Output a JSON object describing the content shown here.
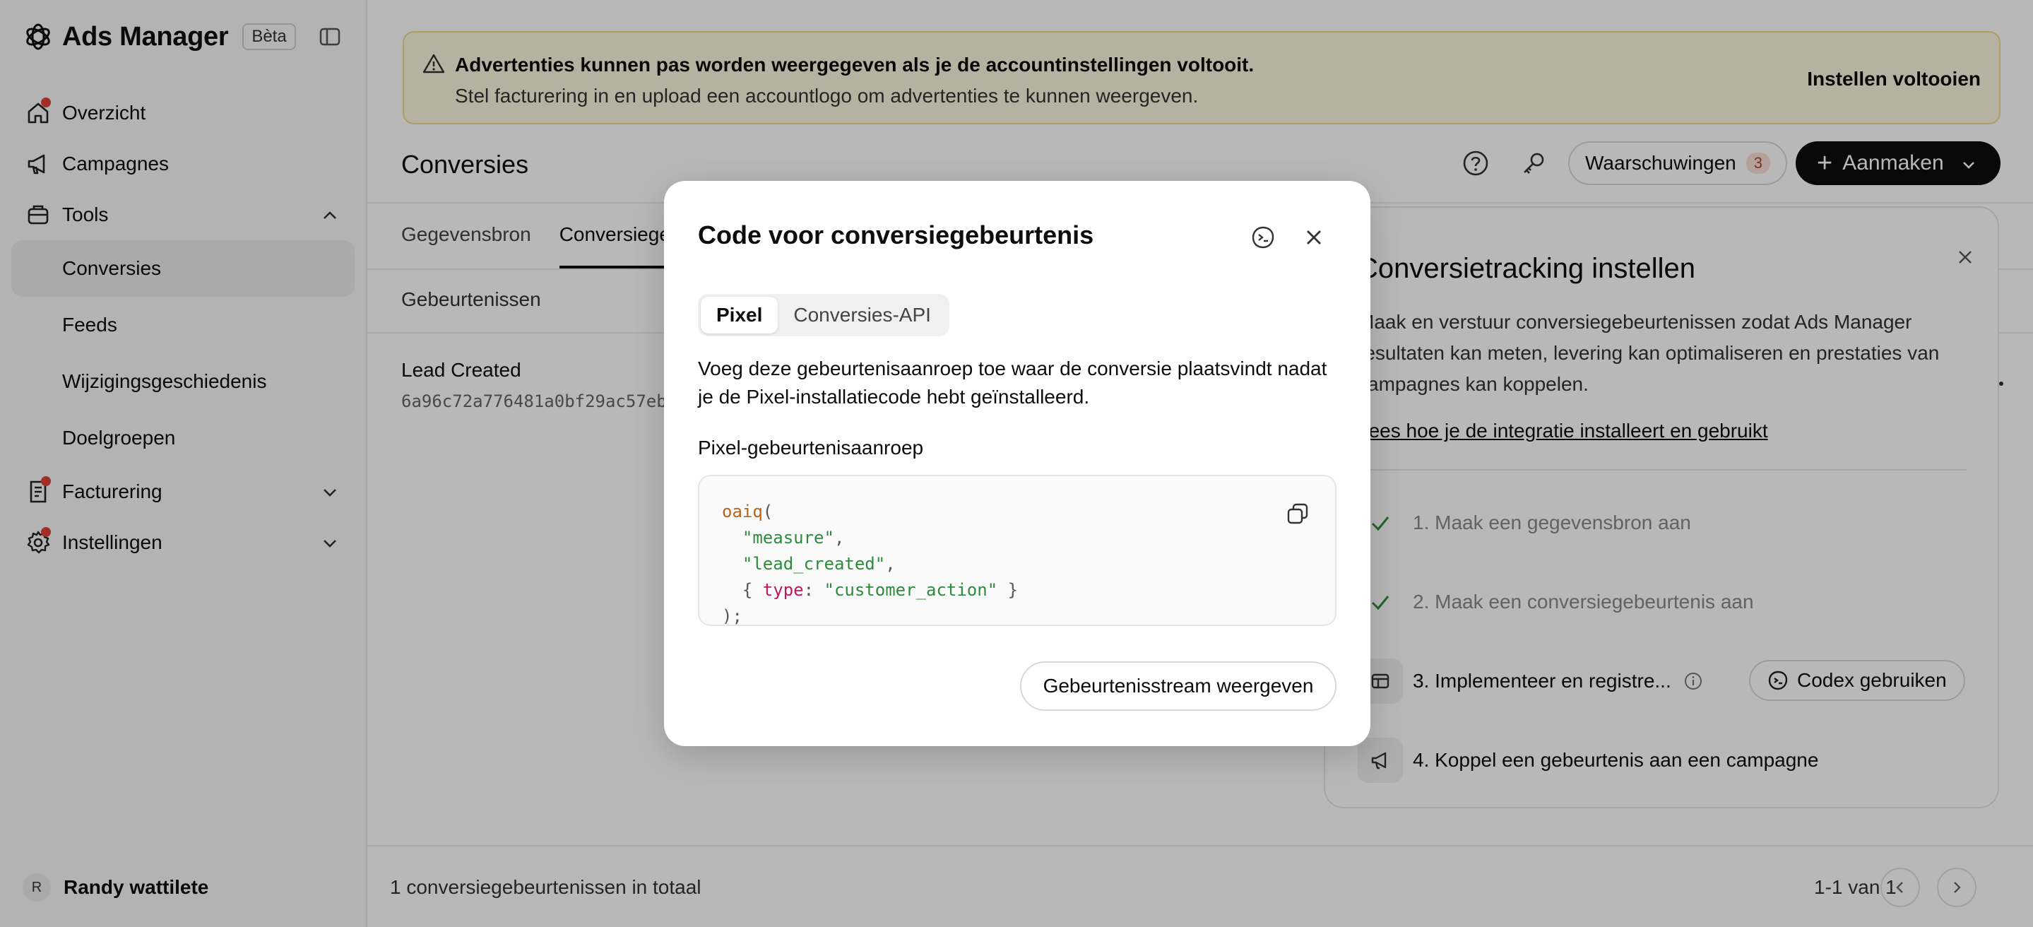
{
  "sidebar": {
    "app_title": "Ads Manager",
    "badge": "Bèta",
    "items": [
      {
        "label": "Overzicht",
        "icon": "home-icon",
        "dot": true
      },
      {
        "label": "Campagnes",
        "icon": "megaphone-icon",
        "dot": false
      },
      {
        "label": "Tools",
        "icon": "toolbox-icon",
        "dot": false,
        "expanded": true
      },
      {
        "label": "Conversies",
        "active": true
      },
      {
        "label": "Feeds"
      },
      {
        "label": "Wijzigingsgeschiedenis"
      },
      {
        "label": "Doelgroepen"
      },
      {
        "label": "Facturering",
        "icon": "receipt-icon",
        "dot": true
      },
      {
        "label": "Instellingen",
        "icon": "gear-icon",
        "dot": true
      }
    ],
    "user": {
      "initial": "R",
      "name": "Randy wattilete"
    }
  },
  "banner": {
    "title": "Advertenties kunnen pas worden weergegeven als je de accountinstellingen voltooit.",
    "text": "Stel facturering in en upload een accountlogo om advertenties te kunnen weergeven.",
    "action": "Instellen voltooien"
  },
  "header": {
    "title": "Conversies",
    "warnings_label": "Waarschuwingen",
    "warnings_count": "3",
    "create_label": "Aanmaken"
  },
  "tabs": [
    "Gegevensbron",
    "Conversiegebeurtenissen"
  ],
  "subhead": "Gebeurtenissen",
  "row": {
    "title": "Lead Created",
    "id": "6a96c72a776481a0bf29ac57eb"
  },
  "panel": {
    "title": "Conversietracking instellen",
    "desc": "Maak en verstuur conversiegebeurtenissen zodat Ads Manager resultaten kan meten, levering kan optimaliseren en prestaties van campagnes kan koppelen.",
    "link": "Lees hoe je de integratie installeert en gebruikt",
    "steps": [
      "1. Maak een gegevensbron aan",
      "2. Maak een conversiegebeurtenis aan",
      "3. Implementeer en registre...",
      "4. Koppel een gebeurtenis aan een campagne"
    ],
    "codex_label": "Codex gebruiken"
  },
  "footer": {
    "total": "1 conversiegebeurtenissen in totaal",
    "range": "1-1 van 1"
  },
  "modal": {
    "title": "Code voor conversiegebeurtenis",
    "tabs": [
      "Pixel",
      "Conversies-API"
    ],
    "desc": "Voeg deze gebeurtenisaanroep toe waar de conversie plaatsvindt nadat je de Pixel-installatiecode hebt geïnstalleerd.",
    "label": "Pixel-gebeurtenisaanroep",
    "code": {
      "fn": "oaiq",
      "arg1": "\"measure\"",
      "arg2": "\"lead_created\"",
      "key": "type",
      "value": "\"customer_action\""
    },
    "button": "Gebeurtenisstream weergeven"
  },
  "colors": {
    "accent": "#0d0d0d",
    "notification_dot": "#e0423a",
    "banner_bg": "#fcf7e0",
    "success": "#2e8b3e"
  }
}
